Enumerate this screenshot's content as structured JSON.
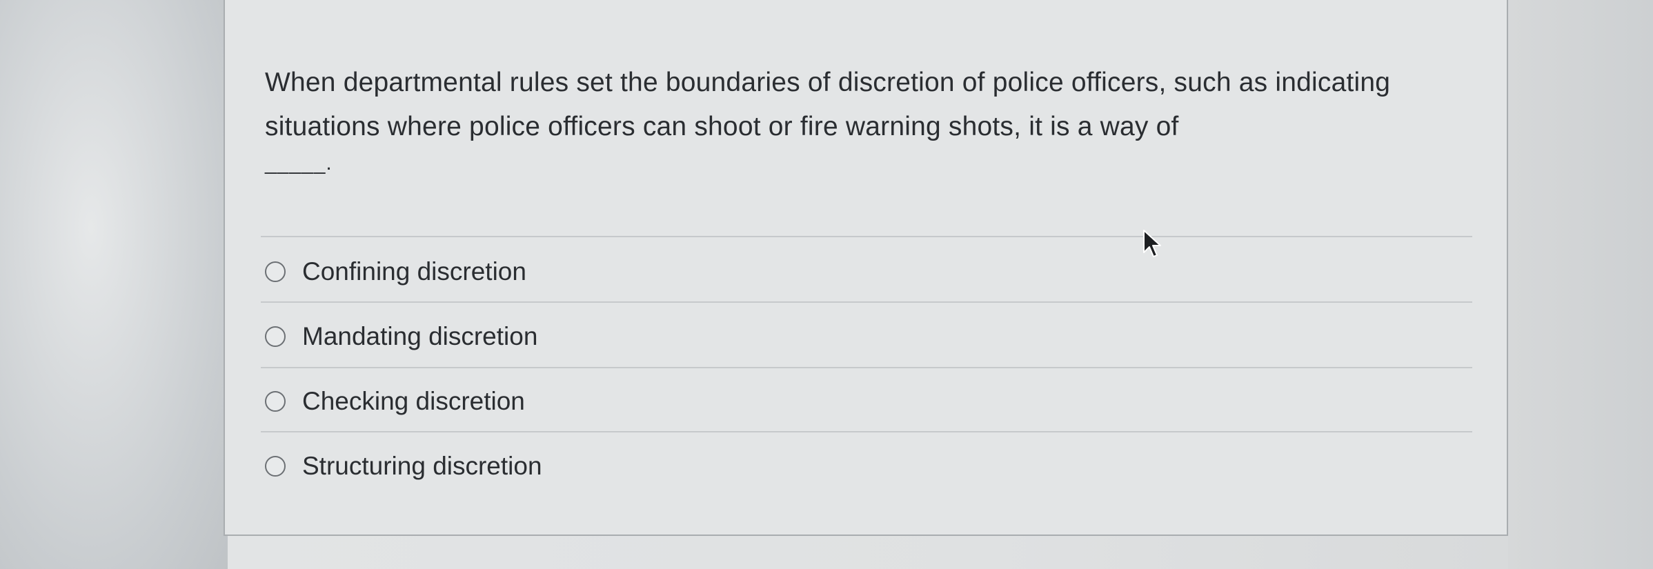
{
  "question": {
    "text": "When departmental rules set the boundaries of discretion of police officers, such as indicating situations where police officers can shoot or fire warning shots, it is a way of",
    "blank": "_____."
  },
  "options": [
    {
      "label": "Confining discretion",
      "selected": false
    },
    {
      "label": "Mandating discretion",
      "selected": false
    },
    {
      "label": "Checking discretion",
      "selected": false
    },
    {
      "label": "Structuring discretion",
      "selected": false
    }
  ],
  "cursor_icon": "mouse-pointer-icon"
}
